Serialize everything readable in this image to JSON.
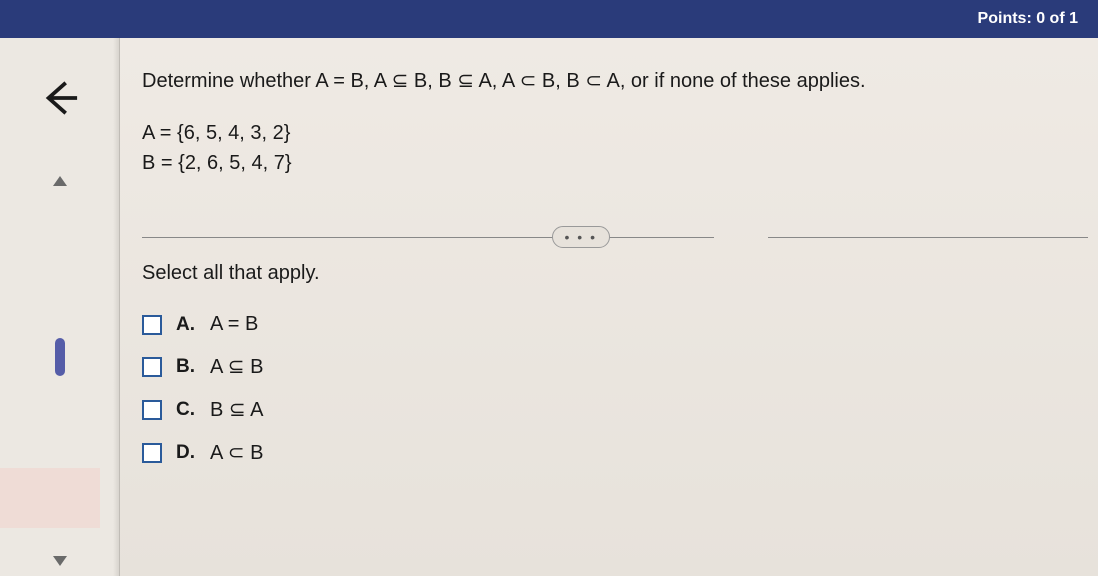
{
  "header": {
    "points": "Points: 0 of 1"
  },
  "question": {
    "prompt": "Determine whether A = B, A ⊆ B, B ⊆ A, A ⊂ B, B ⊂ A, or if none of these applies.",
    "setA": "A = {6, 5, 4, 3, 2}",
    "setB": "B = {2, 6, 5, 4, 7}"
  },
  "instruction": "Select all that apply.",
  "options": [
    {
      "letter": "A.",
      "text": "A = B"
    },
    {
      "letter": "B.",
      "text": "A ⊆ B"
    },
    {
      "letter": "C.",
      "text": "B ⊆ A"
    },
    {
      "letter": "D.",
      "text": "A ⊂ B"
    }
  ],
  "more_label": "• • •"
}
